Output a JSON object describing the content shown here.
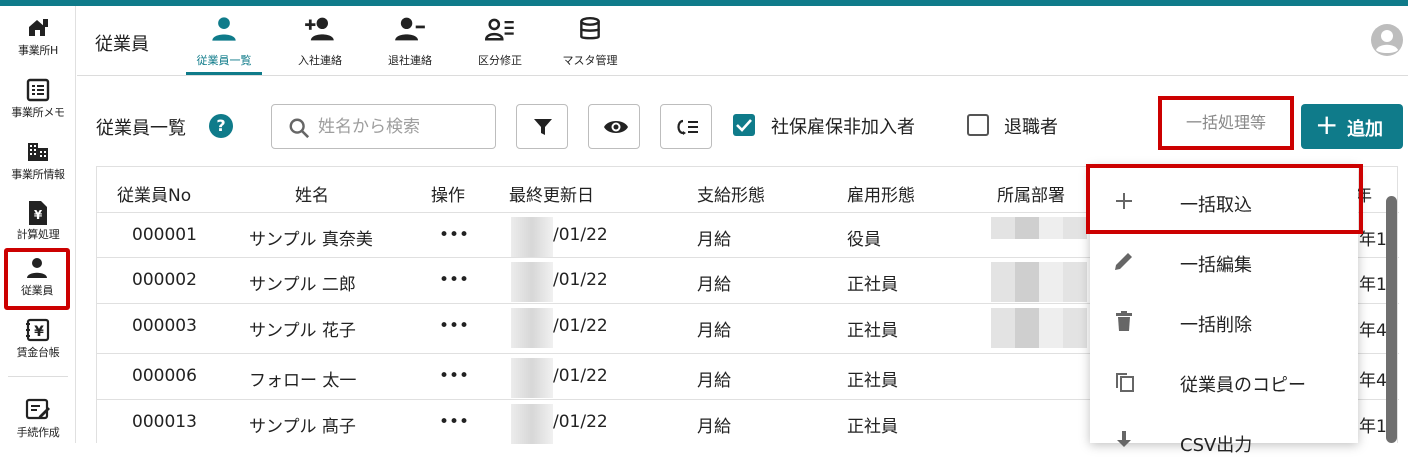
{
  "sidebar": {
    "items": [
      {
        "label": "事業所H",
        "icon": "office-home-icon"
      },
      {
        "label": "事業所メモ",
        "icon": "memo-list-icon"
      },
      {
        "label": "事業所情報",
        "icon": "building-icon"
      },
      {
        "label": "計算処理",
        "icon": "yen-document-icon"
      },
      {
        "label": "従業員",
        "icon": "person-icon"
      },
      {
        "label": "賃金台帳",
        "icon": "ledger-yen-icon"
      },
      {
        "label": "手続作成",
        "icon": "form-edit-icon"
      }
    ]
  },
  "header": {
    "title": "従業員",
    "tabs": [
      {
        "label": "従業員一覧",
        "icon": "person-icon",
        "active": true
      },
      {
        "label": "入社連絡",
        "icon": "person-add-icon"
      },
      {
        "label": "退社連絡",
        "icon": "person-remove-icon"
      },
      {
        "label": "区分修正",
        "icon": "person-list-icon"
      },
      {
        "label": "マスタ管理",
        "icon": "database-icon"
      }
    ]
  },
  "toolbar": {
    "title": "従業員一覧",
    "help": "?",
    "search_placeholder": "姓名から検索",
    "checkbox_insured": {
      "label": "社保雇保非加入者",
      "checked": true
    },
    "checkbox_retired": {
      "label": "退職者",
      "checked": false
    },
    "bulk_label": "一括処理等",
    "add_label": "追加"
  },
  "table": {
    "headers": [
      "従業員No",
      "姓名",
      "操作",
      "最終更新日",
      "支給形態",
      "雇用形態",
      "所属部署",
      "年"
    ],
    "rows": [
      {
        "no": "000001",
        "name": "サンプル 真奈美",
        "ops": "•••",
        "date": "/01/22",
        "pay": "月給",
        "emp": "役員",
        "tail": "年1"
      },
      {
        "no": "000002",
        "name": "サンプル 二郎",
        "ops": "•••",
        "date": "/01/22",
        "pay": "月給",
        "emp": "正社員",
        "tail": "年1"
      },
      {
        "no": "000003",
        "name": "サンプル 花子",
        "ops": "•••",
        "date": "/01/22",
        "pay": "月給",
        "emp": "正社員",
        "tail": "年4"
      },
      {
        "no": "000006",
        "name": "フォロー 太一",
        "ops": "•••",
        "date": "/01/22",
        "pay": "月給",
        "emp": "正社員",
        "tail": "年4"
      },
      {
        "no": "000013",
        "name": "サンプル 髙子",
        "ops": "•••",
        "date": "/01/22",
        "pay": "月給",
        "emp": "正社員",
        "tail": "年1"
      }
    ]
  },
  "menu": {
    "items": [
      {
        "label": "一括取込",
        "icon": "plus-icon"
      },
      {
        "label": "一括編集",
        "icon": "pencil-icon"
      },
      {
        "label": "一括削除",
        "icon": "trash-icon"
      },
      {
        "label": "従業員のコピー",
        "icon": "copy-icon"
      },
      {
        "label": "CSV出力",
        "icon": "download-icon"
      }
    ]
  },
  "colors": {
    "accent": "#0f7b8a",
    "highlight": "#cc0000"
  }
}
